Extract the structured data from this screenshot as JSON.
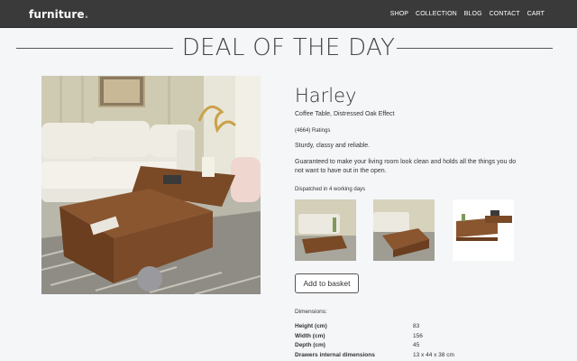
{
  "nav": {
    "brand": "furniture",
    "brand_dot": ".",
    "links": [
      "SHOP",
      "COLLECTION",
      "BLOG",
      "CONTACT",
      "CART"
    ]
  },
  "deal": {
    "title": "DEAL OF THE DAY"
  },
  "product": {
    "name": "Harley",
    "subtitle": "Coffee Table, Distressed Oak Effect",
    "ratings": "(4664) Ratings",
    "tagline": "Sturdy, classy and reliable.",
    "description": "Guaranteed to make your living room look clean and holds all the things you do not want to have out in the open.",
    "dispatch": "Dispatched in 4 working days",
    "add_to_basket": "Add to basket",
    "dimensions_heading": "Dimensions:",
    "dimensions": [
      {
        "label": "Height (cm)",
        "value": "83"
      },
      {
        "label": "Width (cm)",
        "value": "156"
      },
      {
        "label": "Depth (cm)",
        "value": "45"
      },
      {
        "label": "Drawers internal dimensions",
        "value": "13 x 44 x 38 cm"
      }
    ]
  },
  "colors": {
    "nav_bg": "#3a3a3a",
    "page_bg": "#f4f6f8",
    "wood": "#7a4a26"
  }
}
